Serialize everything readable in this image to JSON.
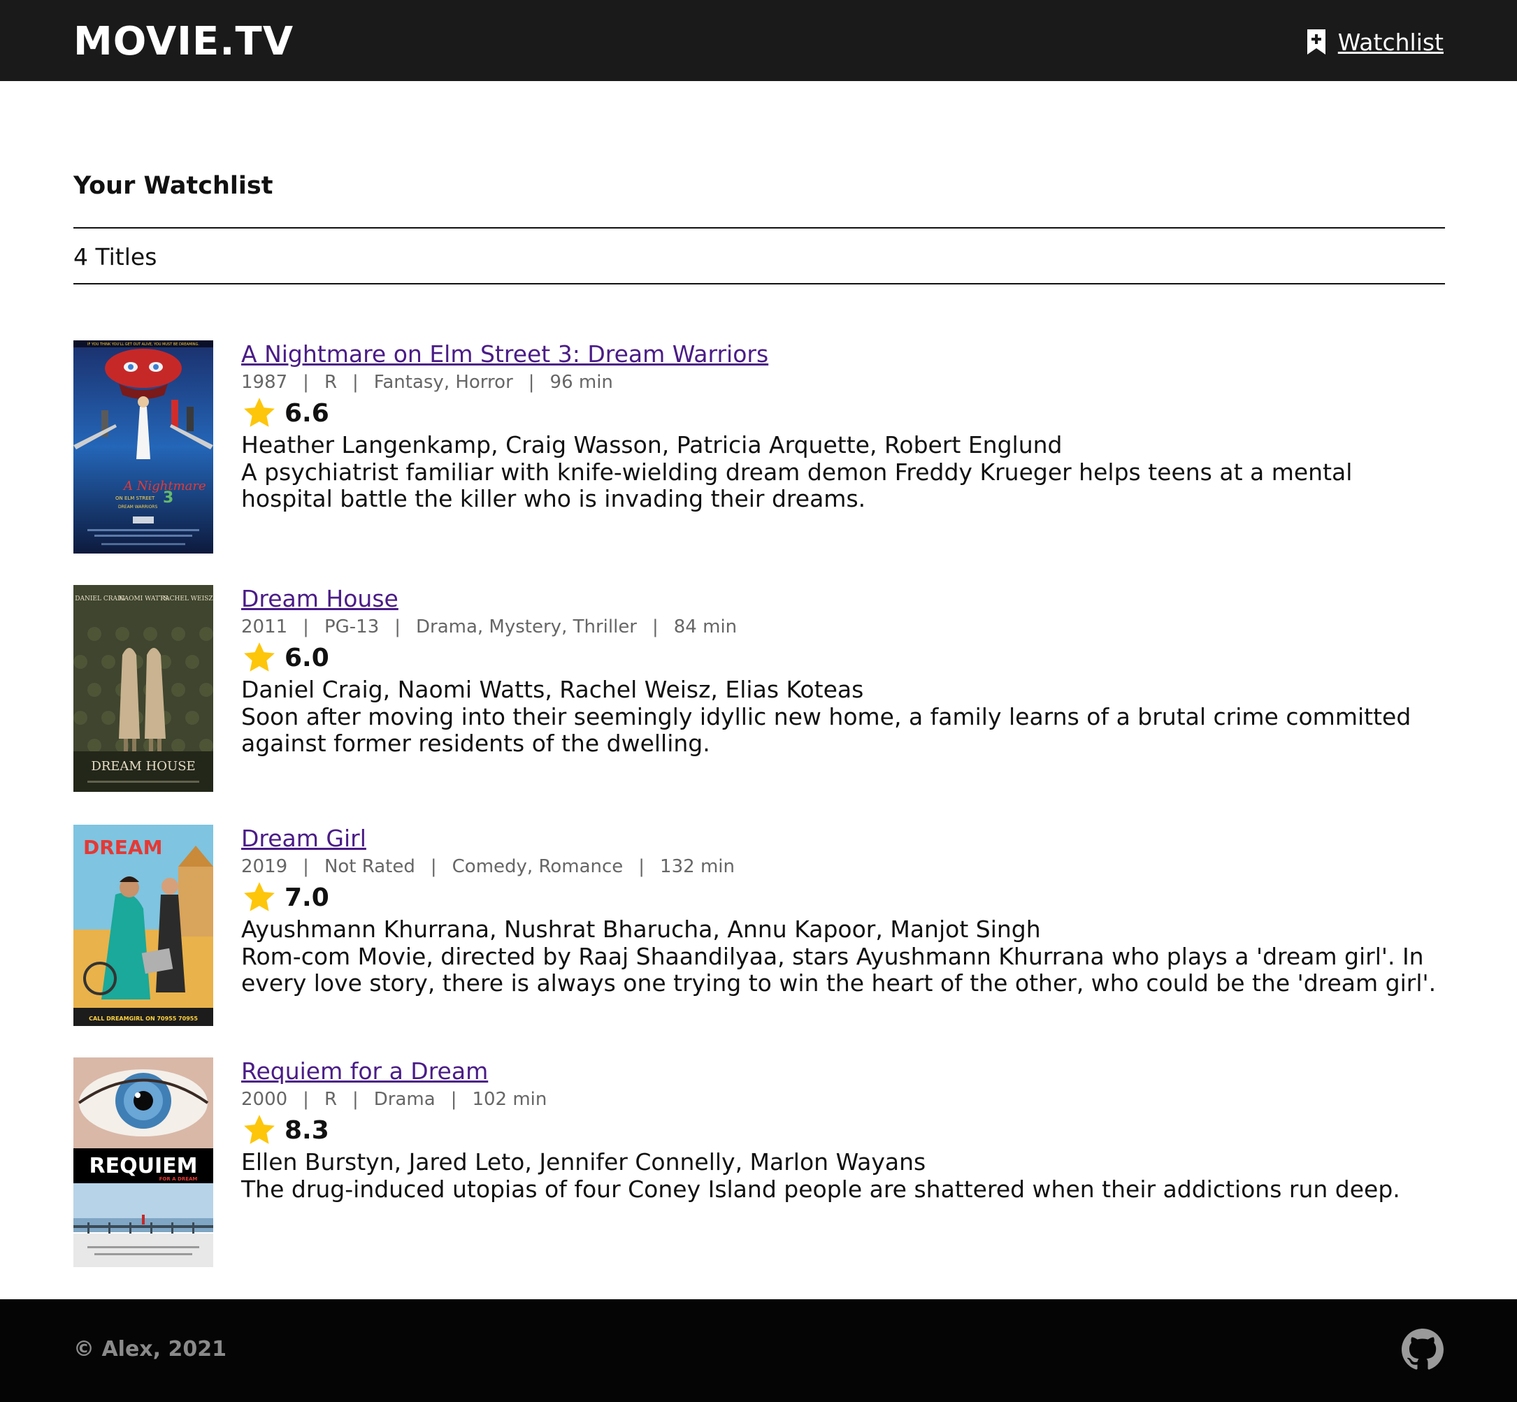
{
  "header": {
    "brand": "MOVIE.TV",
    "watchlist_label": "Watchlist",
    "watchlist_icon": "bookmark-plus-icon"
  },
  "page": {
    "title": "Your Watchlist",
    "count_label": "4 Titles"
  },
  "movies": [
    {
      "title": "A Nightmare on Elm Street 3: Dream Warriors",
      "year": "1987",
      "rating_label": "R",
      "genres": "Fantasy, Horror",
      "runtime": "96 min",
      "score": "6.6",
      "cast": "Heather Langenkamp, Craig Wasson, Patricia Arquette, Robert Englund",
      "plot": "A psychiatrist familiar with knife-wielding dream demon Freddy Krueger helps teens at a mental hospital battle the killer who is invading their dreams.",
      "poster": {
        "tagline": "IF YOU THINK YOU'LL GET OUT ALIVE, YOU MUST BE DREAMING.",
        "logo": "A Nightmare",
        "logo_sub": "ON ELM STREET",
        "logo_num": "3",
        "logo_sub2": "DREAM WARRIORS"
      }
    },
    {
      "title": "Dream House",
      "year": "2011",
      "rating_label": "PG-13",
      "genres": "Drama, Mystery, Thriller",
      "runtime": "84 min",
      "score": "6.0",
      "cast": "Daniel Craig, Naomi Watts, Rachel Weisz, Elias Koteas",
      "plot": "Soon after moving into their seemingly idyllic new home, a family learns of a brutal crime committed against former residents of the dwelling.",
      "poster": {
        "names": [
          "DANIEL CRAIG",
          "NAOMI WATTS",
          "RACHEL WEISZ"
        ],
        "logo": "DREAM HOUSE"
      }
    },
    {
      "title": "Dream Girl",
      "year": "2019",
      "rating_label": "Not Rated",
      "genres": "Comedy, Romance",
      "runtime": "132 min",
      "score": "7.0",
      "cast": "Ayushmann Khurrana, Nushrat Bharucha, Annu Kapoor, Manjot Singh",
      "plot": "Rom-com Movie, directed by Raaj Shaandilyaa, stars Ayushmann Khurrana who plays a 'dream girl'. In every love story, there is always one trying to win the heart of the other, who could be the 'dream girl'.",
      "poster": {
        "logo": "DREAM",
        "footer": "CALL DREAMGIRL ON 70955 70955"
      }
    },
    {
      "title": "Requiem for a Dream",
      "year": "2000",
      "rating_label": "R",
      "genres": "Drama",
      "runtime": "102 min",
      "score": "8.3",
      "cast": "Ellen Burstyn, Jared Leto, Jennifer Connelly, Marlon Wayans",
      "plot": "The drug-induced utopias of four Coney Island people are shattered when their addictions run deep.",
      "poster": {
        "logo": "REQUIEM",
        "logo_sub": "FOR A DREAM"
      }
    }
  ],
  "footer": {
    "copyright": "© Alex, 2021",
    "github_icon": "github-icon"
  },
  "colors": {
    "header_bg": "#1a1a1a",
    "footer_bg": "#050505",
    "link": "#4a1c86",
    "star": "#fdc60b",
    "meta_text": "#666666"
  }
}
